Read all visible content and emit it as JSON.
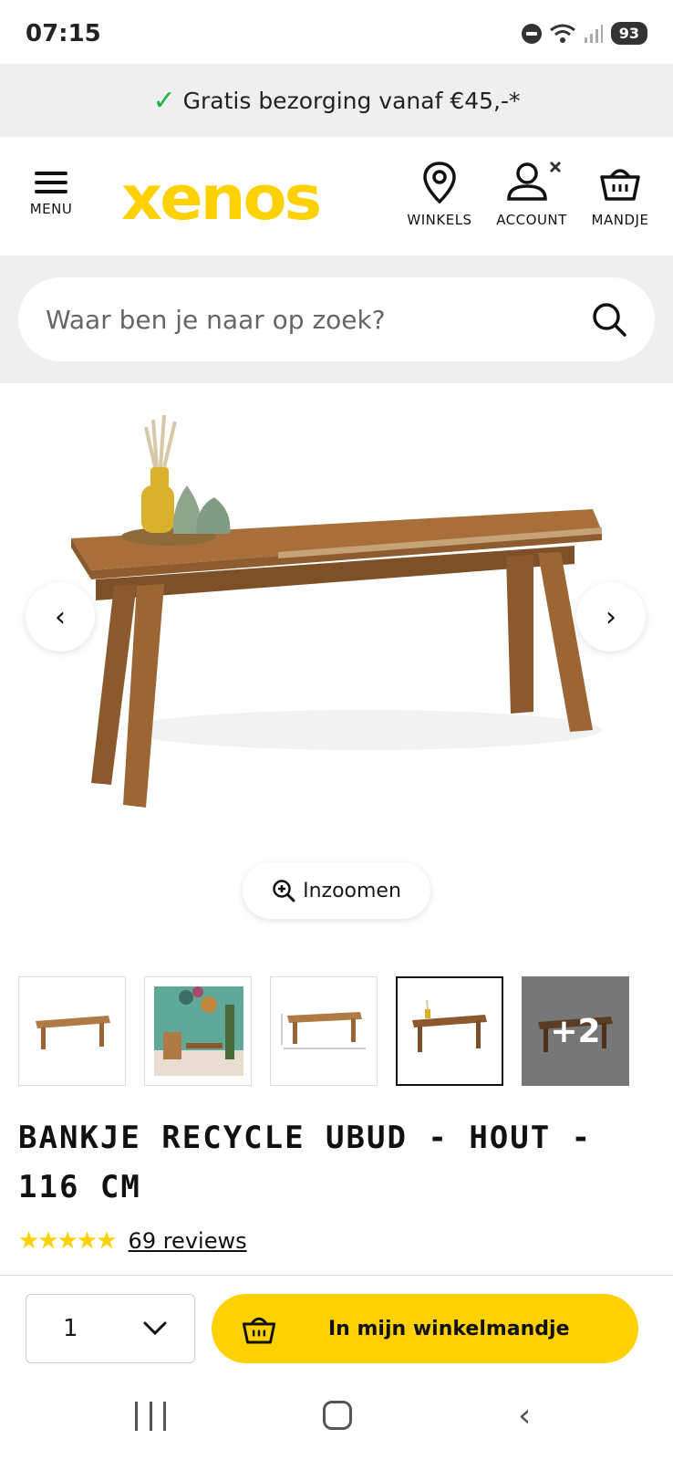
{
  "status_bar": {
    "time": "07:15",
    "battery": "93",
    "icons": [
      "do-not-disturb-icon",
      "wifi-icon",
      "signal-icon",
      "battery-icon"
    ]
  },
  "promo": {
    "text": "Gratis bezorging vanaf €45,-*",
    "icon": "check-icon",
    "icon_color": "#21b24b"
  },
  "header": {
    "logo_text": "xenos",
    "logo_color": "#ffd100",
    "menu_label": "MENU",
    "winkels_label": "WINKELS",
    "account_label": "ACCOUNT",
    "mandje_label": "MANDJE"
  },
  "search": {
    "placeholder": "Waar ben je naar op zoek?"
  },
  "gallery": {
    "zoom_label": "Inzoomen",
    "more_count": "+2",
    "thumbnail_count": 5,
    "active_thumbnail": 4
  },
  "product": {
    "title": "BANKJE RECYCLE UBUD - HOUT - 116 CM",
    "rating": 5,
    "reviews_label": "69 reviews"
  },
  "actionbar": {
    "quantity": "1",
    "cart_label": "In mijn winkelmandje",
    "accent_color": "#ffd100"
  }
}
